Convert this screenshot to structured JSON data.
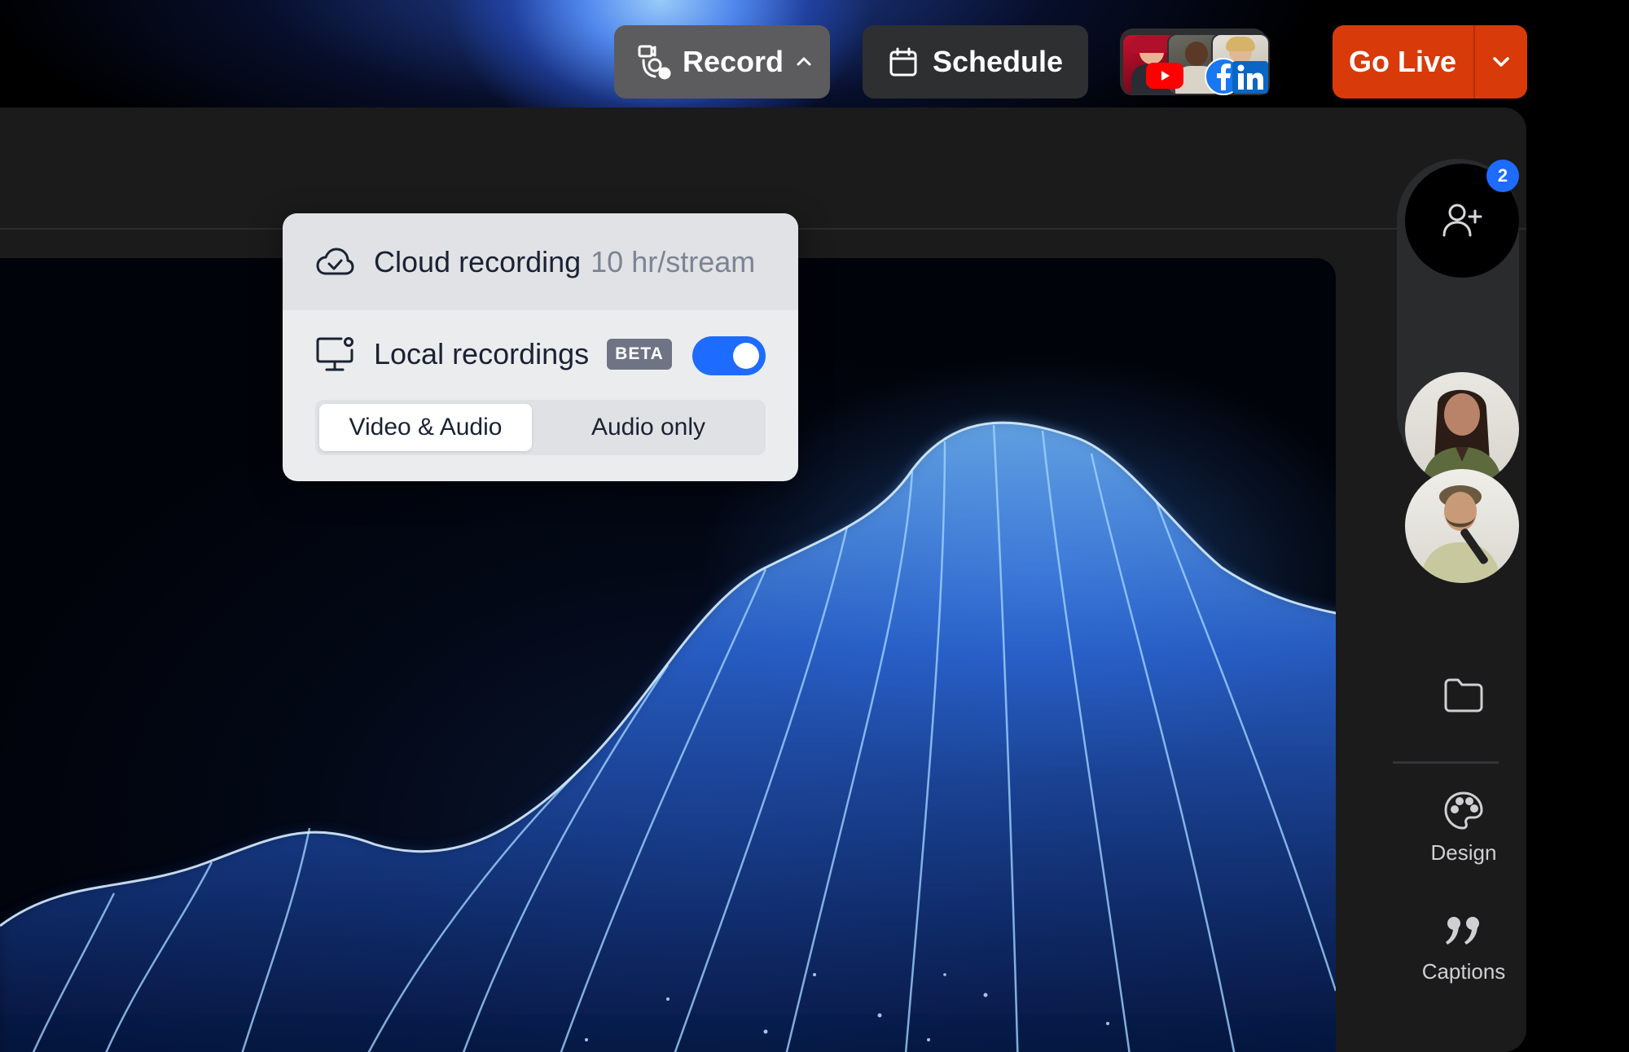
{
  "toolbar": {
    "record_label": "Record",
    "schedule_label": "Schedule",
    "go_live_label": "Go Live",
    "destinations": [
      "youtube-icon",
      "facebook-icon",
      "linkedin-icon"
    ]
  },
  "record_menu": {
    "cloud_label": "Cloud recording",
    "cloud_limit": "10 hr/stream",
    "local_label": "Local recordings",
    "beta_badge": "BETA",
    "local_enabled": true,
    "mode_options": [
      "Video & Audio",
      "Audio only"
    ],
    "mode_selected": "Video & Audio"
  },
  "participants": {
    "pending_count": "2"
  },
  "rail": {
    "design_label": "Design",
    "captions_label": "Captions"
  },
  "colors": {
    "accent_blue": "#1e6bff",
    "go_live": "#d93a09",
    "app_bg": "#1b1b1c"
  }
}
